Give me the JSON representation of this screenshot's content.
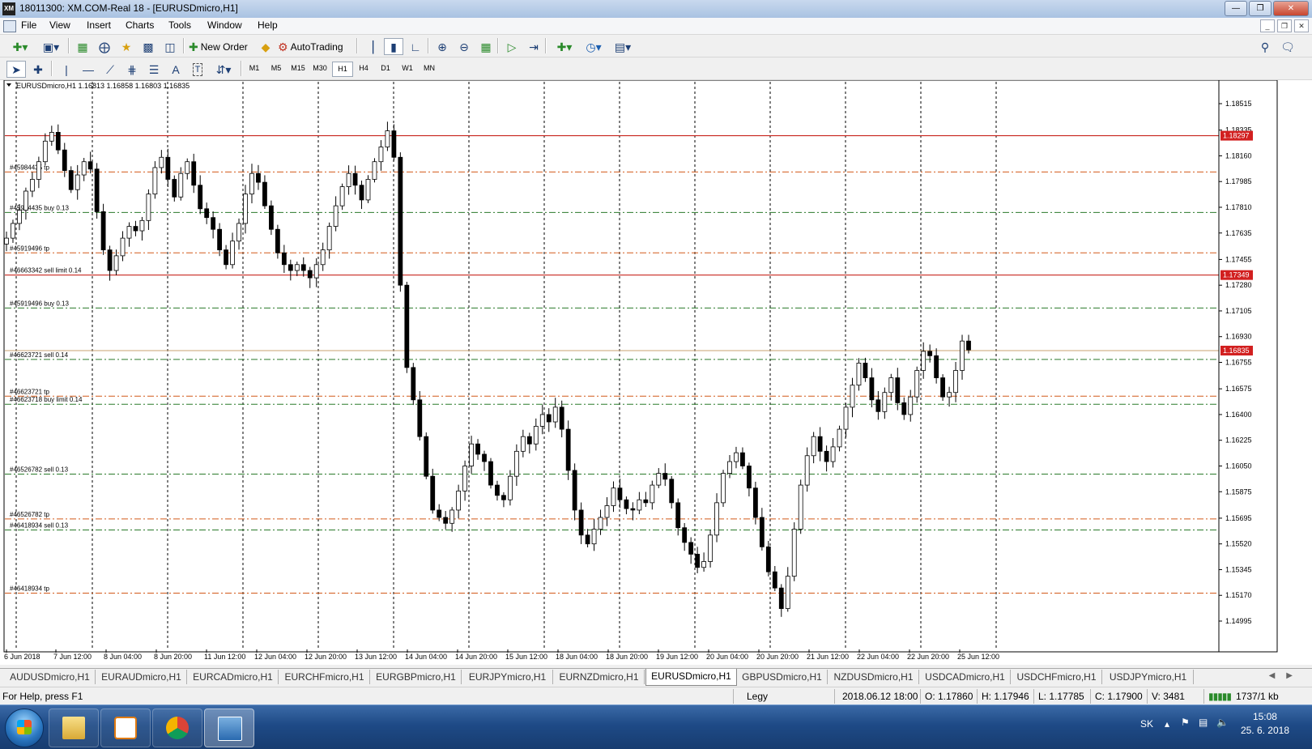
{
  "window": {
    "title": "18011300: XM.COM-Real 18 - [EURUSDmicro,H1]",
    "app_badge": "XM"
  },
  "menu": [
    "File",
    "View",
    "Insert",
    "Charts",
    "Tools",
    "Window",
    "Help"
  ],
  "toolbar": {
    "new_order": "New Order",
    "auto_trading": "AutoTrading"
  },
  "timeframes": [
    "M1",
    "M5",
    "M15",
    "M30",
    "H1",
    "H4",
    "D1",
    "W1",
    "MN"
  ],
  "active_timeframe": "H1",
  "draw_tools": {
    "text_tool": "A",
    "label_tool": "T"
  },
  "chart_data": {
    "type": "candlestick",
    "header": "EURUSDmicro,H1  1.16813 1.16858 1.16803 1.16835",
    "ylim": [
      1.14995,
      1.186
    ],
    "price_ticks": [
      "1.18515",
      "1.18335",
      "1.18160",
      "1.17985",
      "1.17810",
      "1.17635",
      "1.17455",
      "1.17280",
      "1.17105",
      "1.16930",
      "1.16755",
      "1.16575",
      "1.16400",
      "1.16225",
      "1.16050",
      "1.15875",
      "1.15695",
      "1.15520",
      "1.15345",
      "1.15170",
      "1.14995"
    ],
    "time_labels": [
      "6 Jun 2018",
      "7 Jun 12:00",
      "8 Jun 04:00",
      "8 Jun 20:00",
      "11 Jun 12:00",
      "12 Jun 04:00",
      "12 Jun 20:00",
      "13 Jun 12:00",
      "14 Jun 04:00",
      "14 Jun 20:00",
      "15 Jun 12:00",
      "18 Jun 04:00",
      "18 Jun 20:00",
      "19 Jun 12:00",
      "20 Jun 04:00",
      "20 Jun 20:00",
      "21 Jun 12:00",
      "22 Jun 04:00",
      "22 Jun 20:00",
      "25 Jun 12:00"
    ],
    "price_labels": [
      {
        "text": "1.18297",
        "price": 1.18297,
        "color": "#d21f1f"
      },
      {
        "text": "1.17349",
        "price": 1.17349,
        "color": "#d21f1f"
      },
      {
        "text": "1.16835",
        "price": 1.16835,
        "color": "#d21f1f"
      }
    ],
    "order_lines": [
      {
        "label": "#45984435 tp",
        "price": 1.1805,
        "kind": "tp"
      },
      {
        "label": "#45984435 buy 0.13",
        "price": 1.17775,
        "kind": "entry"
      },
      {
        "label": "#45919496 tp",
        "price": 1.175,
        "kind": "tp"
      },
      {
        "label": "#46663342 sell limit 0.14",
        "price": 1.17349,
        "kind": "pending"
      },
      {
        "label": "#45919496 buy 0.13",
        "price": 1.17125,
        "kind": "entry"
      },
      {
        "label": "#46623721 sell 0.14",
        "price": 1.16775,
        "kind": "entry"
      },
      {
        "label": "#46623721 tp",
        "price": 1.16525,
        "kind": "tp"
      },
      {
        "label": "#46623718 buy limit 0.14",
        "price": 1.1647,
        "kind": "entry"
      },
      {
        "label": "#46526782 sell 0.13",
        "price": 1.15995,
        "kind": "entry"
      },
      {
        "label": "#46526782 tp",
        "price": 1.1569,
        "kind": "tp"
      },
      {
        "label": "#46418934 sell 0.13",
        "price": 1.15615,
        "kind": "entry"
      },
      {
        "label": "#46418934 tp",
        "price": 1.15185,
        "kind": "tp"
      }
    ],
    "red_lines": [
      1.18297,
      1.17349
    ],
    "ask_line": 1.16835,
    "series": [
      {
        "name": "close",
        "values": [
          1.176,
          1.177,
          1.1779,
          1.1792,
          1.18,
          1.1812,
          1.1826,
          1.1832,
          1.182,
          1.1806,
          1.1793,
          1.1803,
          1.1812,
          1.1807,
          1.1778,
          1.1752,
          1.1738,
          1.1748,
          1.176,
          1.1768,
          1.1765,
          1.1772,
          1.179,
          1.1808,
          1.1815,
          1.18,
          1.1788,
          1.1804,
          1.1812,
          1.1796,
          1.178,
          1.1774,
          1.1766,
          1.1752,
          1.1742,
          1.1758,
          1.177,
          1.179,
          1.1804,
          1.1798,
          1.1782,
          1.1766,
          1.175,
          1.1742,
          1.1738,
          1.1742,
          1.1738,
          1.1733,
          1.1742,
          1.1752,
          1.1768,
          1.1782,
          1.1795,
          1.1804,
          1.1796,
          1.1786,
          1.18,
          1.1812,
          1.1822,
          1.1833,
          1.1815,
          1.1728,
          1.1672,
          1.165,
          1.1625,
          1.1598,
          1.1575,
          1.157,
          1.1566,
          1.1575,
          1.1588,
          1.1605,
          1.162,
          1.1613,
          1.1608,
          1.1592,
          1.1585,
          1.1582,
          1.1598,
          1.1615,
          1.1625,
          1.162,
          1.1632,
          1.164,
          1.1635,
          1.1645,
          1.163,
          1.1602,
          1.1575,
          1.1558,
          1.1552,
          1.1562,
          1.157,
          1.1578,
          1.159,
          1.1582,
          1.1576,
          1.1575,
          1.1582,
          1.158,
          1.1592,
          1.16,
          1.1596,
          1.158,
          1.1563,
          1.1553,
          1.1545,
          1.1536,
          1.154,
          1.1558,
          1.158,
          1.16,
          1.1608,
          1.1614,
          1.1605,
          1.159,
          1.157,
          1.155,
          1.1533,
          1.1522,
          1.1508,
          1.153,
          1.1562,
          1.1592,
          1.1612,
          1.1625,
          1.1615,
          1.1608,
          1.1618,
          1.163,
          1.1645,
          1.166,
          1.1675,
          1.1665,
          1.165,
          1.1642,
          1.1655,
          1.1665,
          1.1648,
          1.164,
          1.1652,
          1.167,
          1.1683,
          1.168,
          1.1665,
          1.1652,
          1.1655,
          1.167,
          1.169,
          1.1684
        ]
      }
    ]
  },
  "tabs": [
    "AUDUSDmicro,H1",
    "EURAUDmicro,H1",
    "EURCADmicro,H1",
    "EURCHFmicro,H1",
    "EURGBPmicro,H1",
    "EURJPYmicro,H1",
    "EURNZDmicro,H1",
    "EURUSDmicro,H1",
    "GBPUSDmicro,H1",
    "NZDUSDmicro,H1",
    "USDCADmicro,H1",
    "USDCHFmicro,H1",
    "USDJPYmicro,H1"
  ],
  "active_tab": "EURUSDmicro,H1",
  "status": {
    "help": "For Help, press F1",
    "profile": "Legy",
    "datetime": "2018.06.12 18:00",
    "open": "O: 1.17860",
    "high": "H: 1.17946",
    "low": "L: 1.17785",
    "close": "C: 1.17900",
    "volume": "V: 3481",
    "traffic": "1737/1 kb"
  },
  "taskbar": {
    "lang": "SK",
    "time": "15:08",
    "date": "25. 6. 2018"
  },
  "colors": {
    "order_entry": "#2a7a2a",
    "order_tp": "#d25a1a",
    "red_line": "#c8261e",
    "ask_line": "#c8a070",
    "candle": "#000000"
  }
}
